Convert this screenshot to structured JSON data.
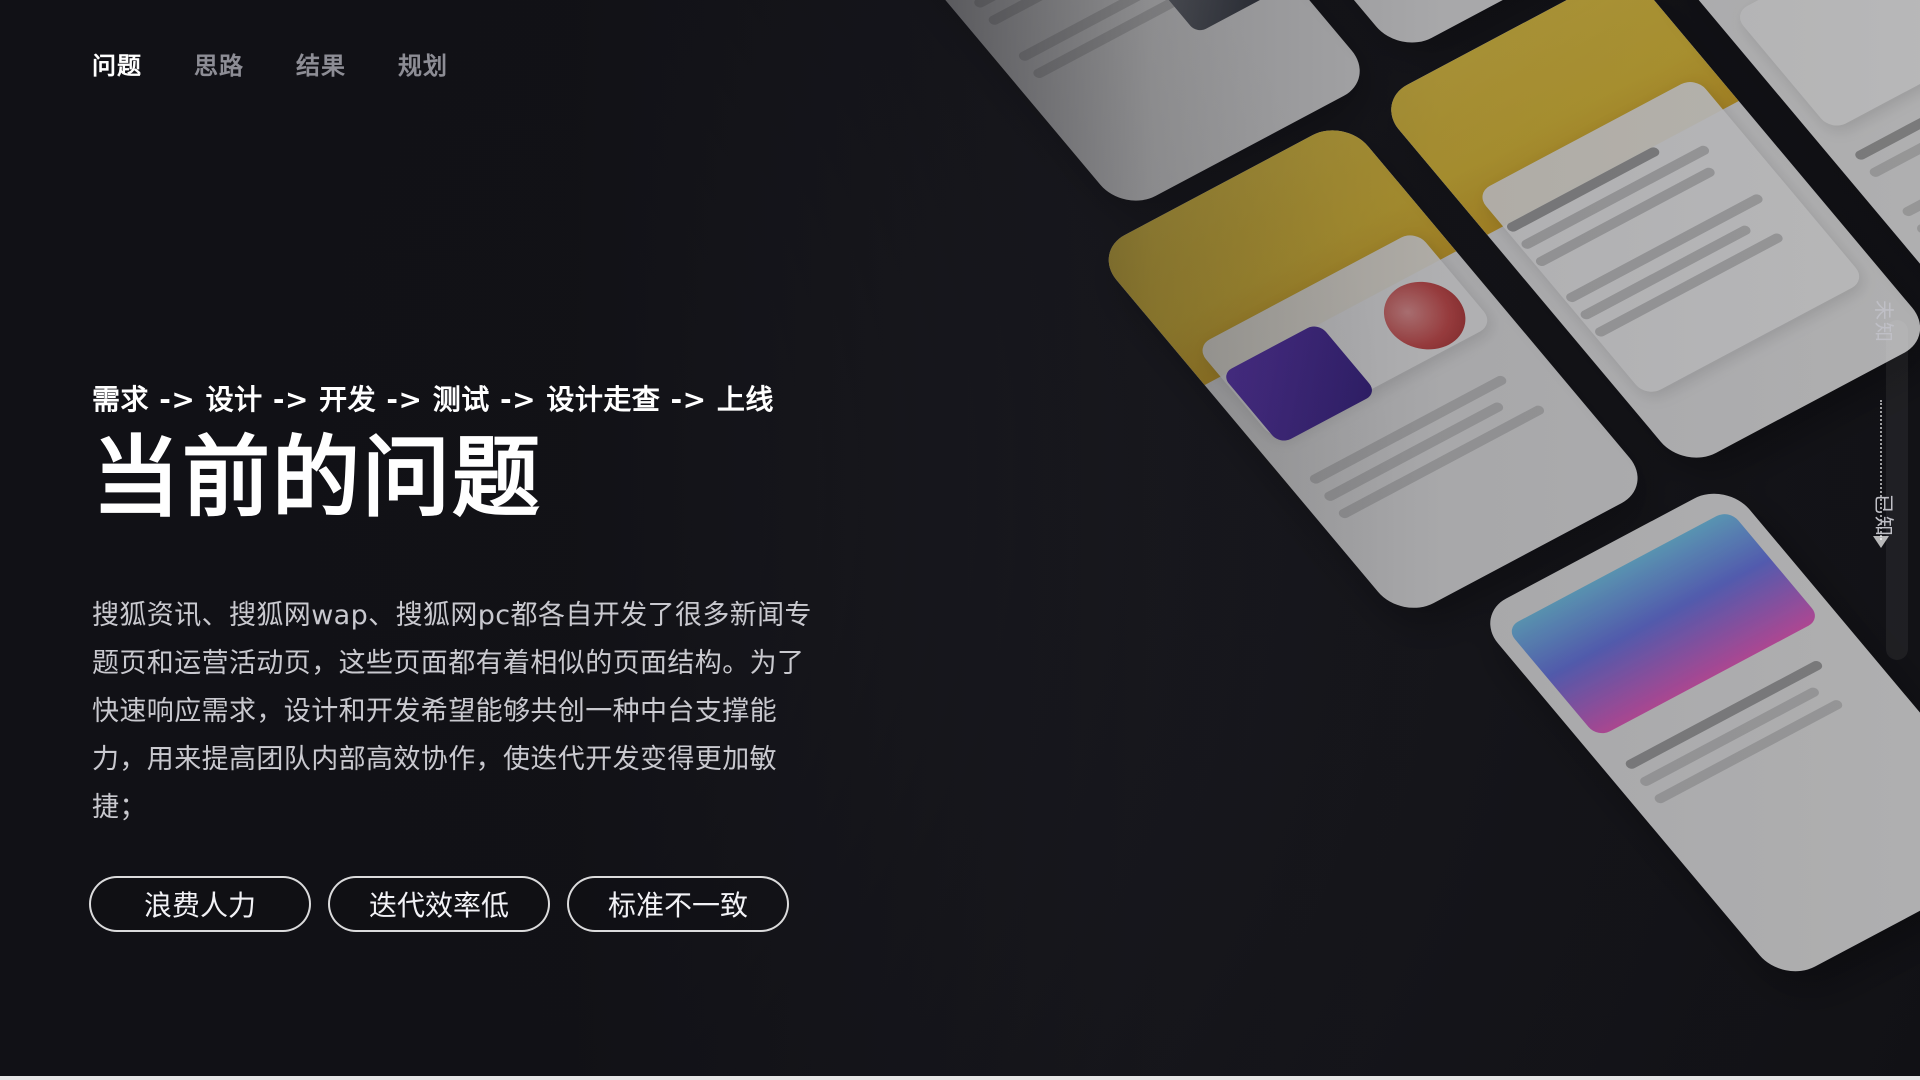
{
  "nav": {
    "items": [
      {
        "label": "问题",
        "active": true
      },
      {
        "label": "思路",
        "active": false
      },
      {
        "label": "结果",
        "active": false
      },
      {
        "label": "规划",
        "active": false
      }
    ]
  },
  "content": {
    "flow": "需求 -> 设计 -> 开发 -> 测试 -> 设计走查 -> 上线",
    "title": "当前的问题",
    "description": "搜狐资讯、搜狐网wap、搜狐网pc都各自开发了很多新闻专题页和运营活动页，这些页面都有着相似的页面结构。为了快速响应需求，设计和开发希望能够共创一种中台支撑能力，用来提高团队内部高效协作，使迭代开发变得更加敏捷；",
    "tags": [
      "浪费人力",
      "迭代效率低",
      "标准不一致"
    ]
  },
  "side": {
    "top": "未知",
    "bottom": "已知"
  },
  "colors": {
    "background": "#121217",
    "text_primary": "#ffffff",
    "text_secondary": "#c9c9cf",
    "nav_inactive": "#8d8d95",
    "accent_yellow": "#f5cf36",
    "accent_blue": "#3b4ad9"
  }
}
